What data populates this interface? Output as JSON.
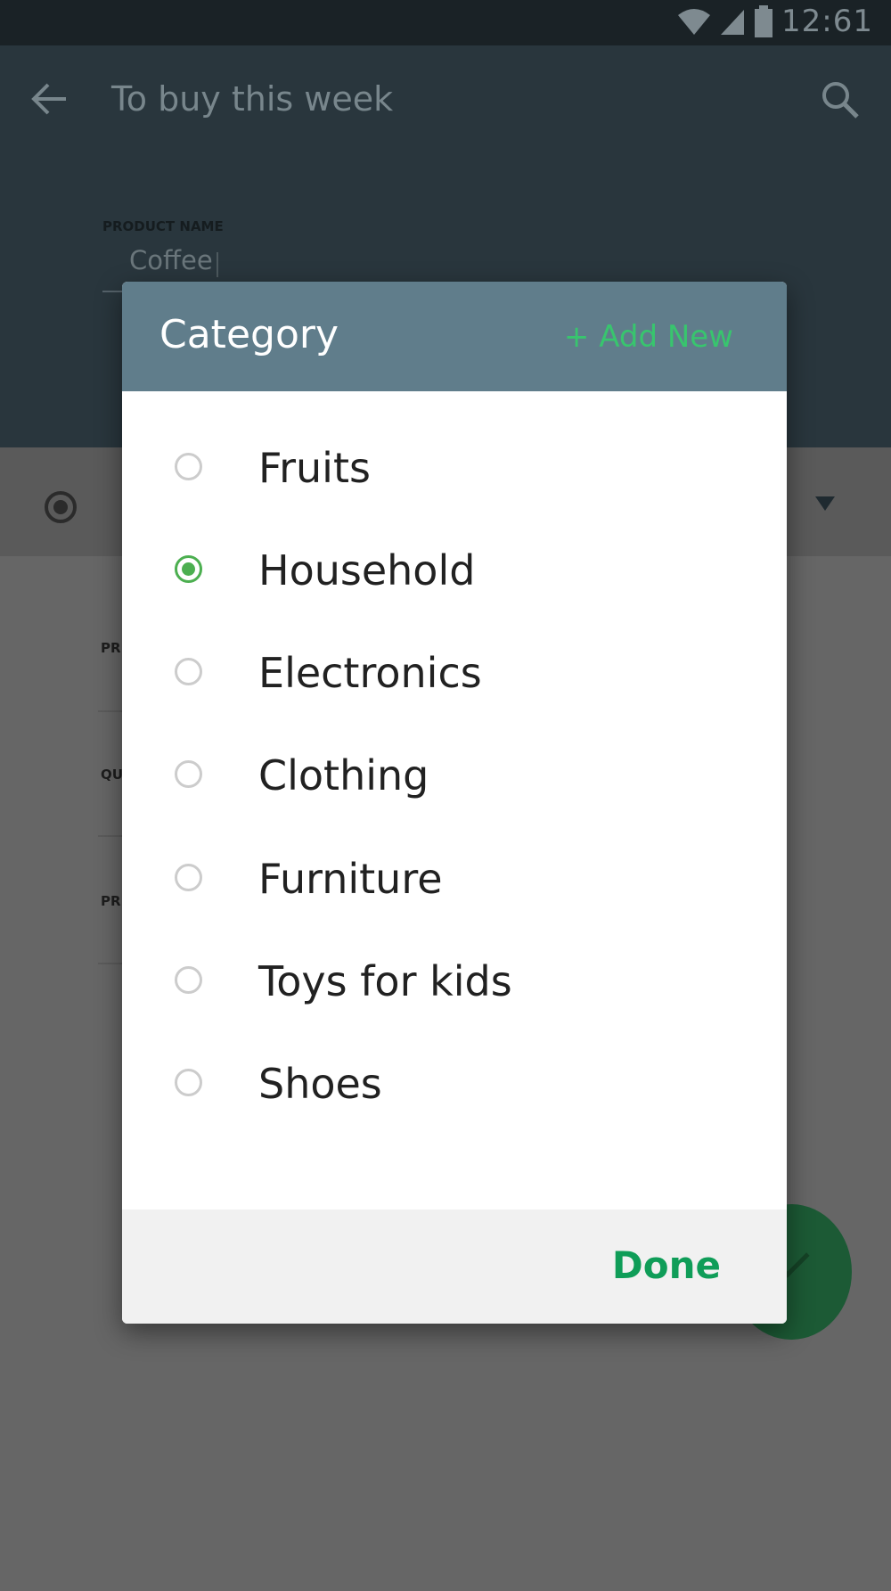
{
  "status_bar": {
    "time": "12:61"
  },
  "app_bar": {
    "title": "To buy this week"
  },
  "product": {
    "label": "PRODUCT NAME",
    "value": "Coffee"
  },
  "background_fields": [
    "PR",
    "QU",
    "PR"
  ],
  "dialog": {
    "title": "Category",
    "add_new": "+ Add New",
    "options": [
      {
        "label": "Fruits",
        "selected": false
      },
      {
        "label": "Household",
        "selected": true
      },
      {
        "label": "Electronics",
        "selected": false
      },
      {
        "label": "Clothing",
        "selected": false
      },
      {
        "label": "Furniture",
        "selected": false
      },
      {
        "label": "Toys for kids",
        "selected": false
      },
      {
        "label": "Shoes",
        "selected": false
      }
    ],
    "done_label": "Done"
  },
  "colors": {
    "header": "#607d8b",
    "accent": "#4caf50",
    "add_new": "#38c56e",
    "done": "#0f9d58"
  }
}
